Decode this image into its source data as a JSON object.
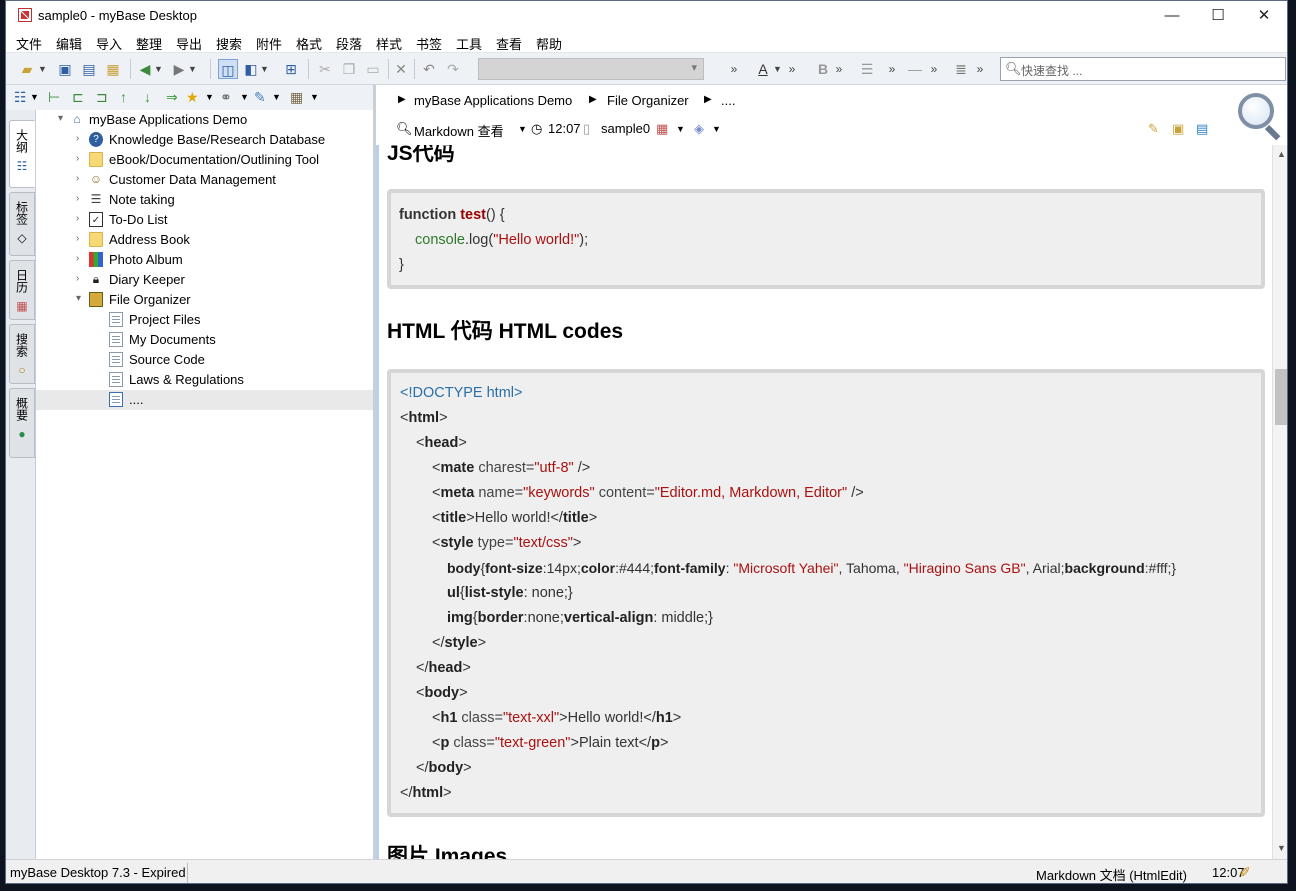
{
  "window": {
    "title": "sample0 - myBase Desktop",
    "minimize": "—",
    "maximize": "☐",
    "close": "✕"
  },
  "menu": [
    "文件",
    "编辑",
    "导入",
    "整理",
    "导出",
    "搜索",
    "附件",
    "格式",
    "段落",
    "样式",
    "书签",
    "工具",
    "查看",
    "帮助"
  ],
  "toolbar": {
    "search_placeholder": "快速查找 ..."
  },
  "sidebar_tabs": [
    "大纲",
    "标签",
    "日历",
    "搜索",
    "概要"
  ],
  "tree": {
    "root": "myBase Applications Demo",
    "items": [
      {
        "label": "Knowledge Base/Research Database",
        "icon": "help-circle-icon"
      },
      {
        "label": "eBook/Documentation/Outlining Tool",
        "icon": "folder-icon"
      },
      {
        "label": "Customer Data Management",
        "icon": "people-icon"
      },
      {
        "label": "Note taking",
        "icon": "note-icon"
      },
      {
        "label": "To-Do List",
        "icon": "checklist-icon"
      },
      {
        "label": "Address Book",
        "icon": "folder-icon"
      },
      {
        "label": "Photo Album",
        "icon": "photo-icon"
      },
      {
        "label": "Diary Keeper",
        "icon": "lock-icon"
      },
      {
        "label": "File Organizer",
        "icon": "cabinet-icon"
      }
    ],
    "children": [
      "Project Files",
      "My Documents",
      "Source Code",
      "Laws & Regulations",
      "...."
    ]
  },
  "breadcrumb": [
    "myBase Applications Demo",
    "File Organizer",
    "...."
  ],
  "doc_header": {
    "view": "Markdown 查看",
    "time": "12:07",
    "name": "sample0"
  },
  "content": {
    "h_js": "JS代码",
    "js": {
      "l1_kw": "function",
      "l1_fn": "test",
      "l1_rest": "() {",
      "l2_obj": "console",
      "l2_m": ".log(",
      "l2_str": "\"Hello world!\"",
      "l2_end": ");",
      "l3": "}"
    },
    "h_html": "HTML 代码 HTML codes",
    "html": {
      "doctype": "<!DOCTYPE html>",
      "l_html": "html",
      "l_head": "head",
      "mate_attr": "charest=",
      "mate_val": "\"utf-8\"",
      "meta_attr1": "name=",
      "meta_val1": "\"keywords\"",
      "meta_attr2": "content=",
      "meta_val2": "\"Editor.md, Markdown, Editor\"",
      "title_text": "Hello world!",
      "style_attr": "type=",
      "style_val": "\"text/css\"",
      "css1_pre": "body{",
      "css1_p1": "font-size",
      "css1_v1": ":14px;",
      "css1_p2": "color",
      "css1_v2": ":#444;",
      "css1_p3": "font-family",
      "css1_v3a": ": ",
      "css1_s1": "\"Microsoft Yahei\"",
      "css1_v3b": ", Tahoma, ",
      "css1_s2": "\"Hiragino Sans GB\"",
      "css1_v3c": ", Arial;",
      "css1_p4": "background",
      "css1_v4": ":#fff;}",
      "css2_sel": "ul",
      "css2_p": "list-style",
      "css2_v": ": none;}",
      "css3_sel": "img",
      "css3_p1": "border",
      "css3_v1": ":none;",
      "css3_p2": "vertical-align",
      "css3_v2": ": middle;}",
      "h1_attr": "class=",
      "h1_val": "\"text-xxl\"",
      "h1_text": "Hello world!",
      "p_attr": "class=",
      "p_val": "\"text-green\"",
      "p_text": "Plain text"
    },
    "h_img": "图片 Images"
  },
  "status": {
    "left": "myBase Desktop 7.3 - Expired",
    "doc": "Markdown 文档 (HtmlEdit)",
    "time": "12:07"
  }
}
